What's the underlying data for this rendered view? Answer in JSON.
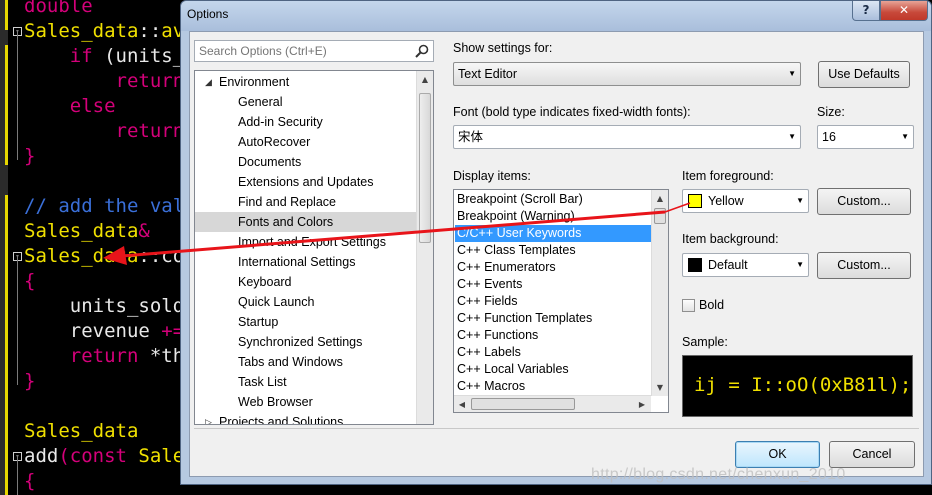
{
  "editor": {
    "lines": [
      {
        "parts": [
          {
            "t": "double",
            "c": "c-kw"
          }
        ]
      },
      {
        "fold": "-",
        "parts": [
          {
            "t": "Sales_data",
            "c": "c-type"
          },
          {
            "t": "::",
            "c": "c-txt"
          },
          {
            "t": "av",
            "c": "c-type"
          }
        ]
      },
      {
        "parts": [
          {
            "t": "    ",
            "c": "c-txt"
          },
          {
            "t": "if",
            "c": "c-kw"
          },
          {
            "t": " (units_",
            "c": "c-txt"
          }
        ]
      },
      {
        "parts": [
          {
            "t": "        ",
            "c": "c-txt"
          },
          {
            "t": "return",
            "c": "c-kw"
          }
        ]
      },
      {
        "parts": [
          {
            "t": "    ",
            "c": "c-txt"
          },
          {
            "t": "else",
            "c": "c-kw"
          }
        ]
      },
      {
        "parts": [
          {
            "t": "        ",
            "c": "c-txt"
          },
          {
            "t": "return",
            "c": "c-kw"
          }
        ]
      },
      {
        "parts": [
          {
            "t": "}",
            "c": "c-kw"
          }
        ]
      },
      {
        "parts": [
          {
            "t": "",
            "c": "c-txt"
          }
        ]
      },
      {
        "parts": [
          {
            "t": "// add the val",
            "c": "c-cm"
          }
        ]
      },
      {
        "parts": [
          {
            "t": "Sales_data",
            "c": "c-type"
          },
          {
            "t": "&",
            "c": "c-kw"
          }
        ]
      },
      {
        "fold": "-",
        "parts": [
          {
            "t": "Sales_data",
            "c": "c-type"
          },
          {
            "t": "::co",
            "c": "c-txt"
          }
        ]
      },
      {
        "parts": [
          {
            "t": "{",
            "c": "c-kw"
          }
        ]
      },
      {
        "parts": [
          {
            "t": "    units_sold",
            "c": "c-txt"
          }
        ]
      },
      {
        "parts": [
          {
            "t": "    revenue ",
            "c": "c-txt"
          },
          {
            "t": "+=",
            "c": "c-kw"
          }
        ]
      },
      {
        "parts": [
          {
            "t": "    ",
            "c": "c-txt"
          },
          {
            "t": "return",
            "c": "c-kw"
          },
          {
            "t": " *th",
            "c": "c-txt"
          }
        ]
      },
      {
        "parts": [
          {
            "t": "}",
            "c": "c-kw"
          }
        ]
      },
      {
        "parts": [
          {
            "t": "",
            "c": "c-txt"
          }
        ]
      },
      {
        "parts": [
          {
            "t": "Sales_data",
            "c": "c-type"
          }
        ]
      },
      {
        "fold": "-",
        "parts": [
          {
            "t": "add",
            "c": "c-txt"
          },
          {
            "t": "(",
            "c": "c-kw"
          },
          {
            "t": "const",
            "c": "c-kw"
          },
          {
            "t": " Sale",
            "c": "c-type"
          }
        ]
      },
      {
        "parts": [
          {
            "t": "{",
            "c": "c-kw"
          }
        ]
      },
      {
        "parts": [
          {
            "t": "    Sales_dat",
            "c": "c-txt"
          }
        ]
      }
    ]
  },
  "dialog": {
    "title": "Options",
    "help_glyph": "?",
    "close_glyph": "✕",
    "search": {
      "placeholder": "Search Options (Ctrl+E)",
      "icon": "search-icon"
    },
    "tree": {
      "items": [
        {
          "label": "Environment",
          "level": 0,
          "expanded": true
        },
        {
          "label": "General",
          "level": 1
        },
        {
          "label": "Add-in Security",
          "level": 1
        },
        {
          "label": "AutoRecover",
          "level": 1
        },
        {
          "label": "Documents",
          "level": 1
        },
        {
          "label": "Extensions and Updates",
          "level": 1
        },
        {
          "label": "Find and Replace",
          "level": 1
        },
        {
          "label": "Fonts and Colors",
          "level": 1,
          "selected": true
        },
        {
          "label": "Import and Export Settings",
          "level": 1
        },
        {
          "label": "International Settings",
          "level": 1
        },
        {
          "label": "Keyboard",
          "level": 1
        },
        {
          "label": "Quick Launch",
          "level": 1
        },
        {
          "label": "Startup",
          "level": 1
        },
        {
          "label": "Synchronized Settings",
          "level": 1
        },
        {
          "label": "Tabs and Windows",
          "level": 1
        },
        {
          "label": "Task List",
          "level": 1
        },
        {
          "label": "Web Browser",
          "level": 1
        },
        {
          "label": "Projects and Solutions",
          "level": 0,
          "expanded": false
        }
      ]
    },
    "show_settings_for": {
      "label": "Show settings for:",
      "value": "Text Editor"
    },
    "use_defaults_label": "Use Defaults",
    "font": {
      "label": "Font (bold type indicates fixed-width fonts):",
      "value": "宋体"
    },
    "size": {
      "label": "Size:",
      "value": "16"
    },
    "display_items": {
      "label": "Display items:",
      "items": [
        "Breakpoint (Scroll Bar)",
        "Breakpoint (Warning)",
        "C/C++ User Keywords",
        "C++ Class Templates",
        "C++ Enumerators",
        "C++ Events",
        "C++ Fields",
        "C++ Function Templates",
        "C++ Functions",
        "C++ Labels",
        "C++ Local Variables",
        "C++ Macros"
      ],
      "selected_index": 2
    },
    "foreground": {
      "label": "Item foreground:",
      "value": "Yellow",
      "color": "#ffff00",
      "custom_label": "Custom..."
    },
    "background": {
      "label": "Item background:",
      "value": "Default",
      "color": "#000000",
      "custom_label": "Custom..."
    },
    "bold_label": "Bold",
    "bold_checked": false,
    "sample": {
      "label": "Sample:",
      "text": "ij = I::oO(0xB81l);",
      "fg": "#f0e000",
      "bg": "#000000"
    },
    "ok_label": "OK",
    "cancel_label": "Cancel"
  },
  "annotation": {
    "color": "#e8141a"
  },
  "watermark": "http://blog.csdn.net/chenxun_2010"
}
